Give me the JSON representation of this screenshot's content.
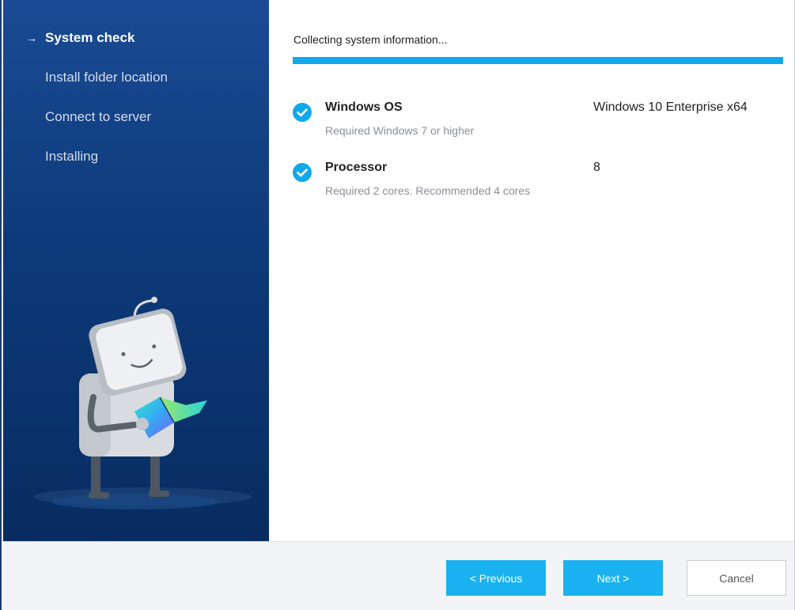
{
  "sidebar": {
    "steps": [
      {
        "label": "System check",
        "active": true
      },
      {
        "label": "Install folder location",
        "active": false
      },
      {
        "label": "Connect to server",
        "active": false
      },
      {
        "label": "Installing",
        "active": false
      }
    ],
    "active_marker": "→"
  },
  "main": {
    "status_text": "Collecting system information...",
    "progress_fraction": 1.0,
    "checks": [
      {
        "name": "Windows OS",
        "requirement": "Required Windows 7 or higher",
        "value": "Windows 10 Enterprise x64",
        "status_icon": "check-circle-icon"
      },
      {
        "name": "Processor",
        "requirement": "Required 2 cores. Recommended 4 cores",
        "value": "8",
        "status_icon": "check-circle-icon"
      }
    ]
  },
  "footer": {
    "previous_label": "< Previous",
    "next_label": "Next >",
    "cancel_label": "Cancel"
  },
  "colors": {
    "accent": "#1ab2f0",
    "sidebar_top": "#1a4b94",
    "sidebar_bottom": "#082c61",
    "check_icon": "#0fa9e9"
  }
}
